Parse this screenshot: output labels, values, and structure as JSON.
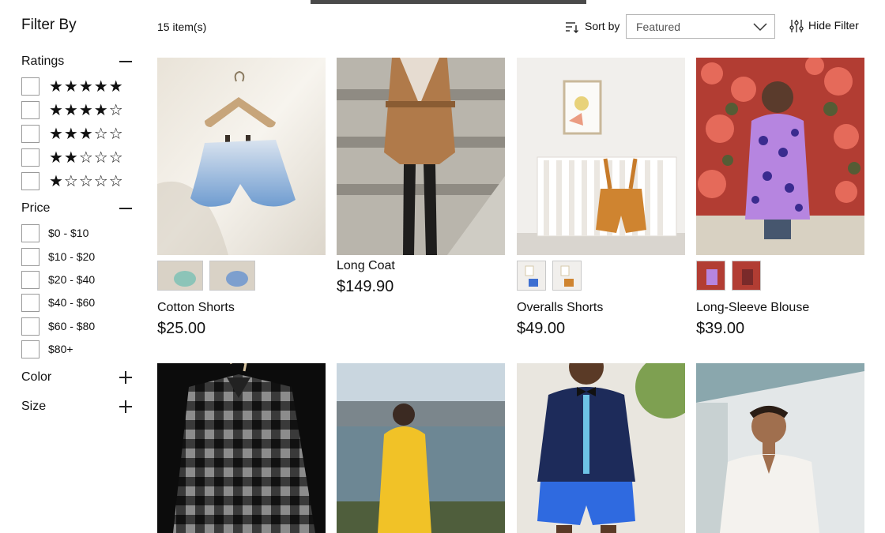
{
  "sidebar": {
    "title": "Filter By",
    "ratings": {
      "label": "Ratings",
      "options": [
        "★★★★★",
        "★★★★☆",
        "★★★☆☆",
        "★★☆☆☆",
        "★☆☆☆☆"
      ]
    },
    "price": {
      "label": "Price",
      "options": [
        "$0 - $10",
        "$10 - $20",
        "$20 - $40",
        "$40 - $60",
        "$60 - $80",
        "$80+"
      ]
    },
    "color": {
      "label": "Color"
    },
    "size": {
      "label": "Size"
    }
  },
  "toolbar": {
    "count": "15 item(s)",
    "sort_label": "Sort by",
    "sort_value": "Featured",
    "hide_filter": "Hide Filter"
  },
  "products": [
    {
      "name": "Cotton Shorts",
      "price": "$25.00"
    },
    {
      "name": "Long Coat",
      "price": "$149.90"
    },
    {
      "name": "Overalls Shorts",
      "price": "$49.00"
    },
    {
      "name": "Long-Sleeve Blouse",
      "price": "$39.00"
    }
  ],
  "colors": {
    "text": "#111111",
    "border": "#9a9a9a"
  }
}
